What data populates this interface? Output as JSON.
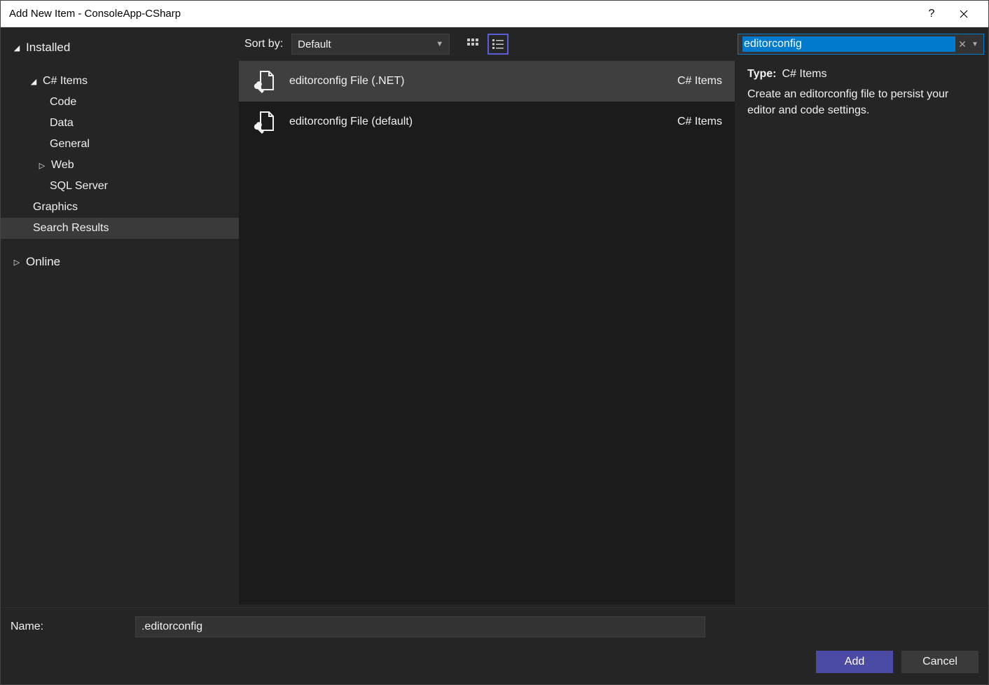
{
  "titlebar": {
    "title": "Add New Item - ConsoleApp-CSharp"
  },
  "sidebar": {
    "installed": "Installed",
    "csharp_items": "C# Items",
    "code": "Code",
    "data": "Data",
    "general": "General",
    "web": "Web",
    "sql_server": "SQL Server",
    "graphics": "Graphics",
    "search_results": "Search Results",
    "online": "Online"
  },
  "toolbar": {
    "sort_label": "Sort by:",
    "sort_value": "Default"
  },
  "search": {
    "value": "editorconfig"
  },
  "templates": [
    {
      "label": "editorconfig File (.NET)",
      "category": "C# Items",
      "selected": true
    },
    {
      "label": "editorconfig File (default)",
      "category": "C# Items",
      "selected": false
    }
  ],
  "details": {
    "type_key": "Type:",
    "type_value": "C# Items",
    "description": "Create an editorconfig file to persist your editor and code settings."
  },
  "footer": {
    "name_label": "Name:",
    "name_value": ".editorconfig",
    "add": "Add",
    "cancel": "Cancel"
  }
}
